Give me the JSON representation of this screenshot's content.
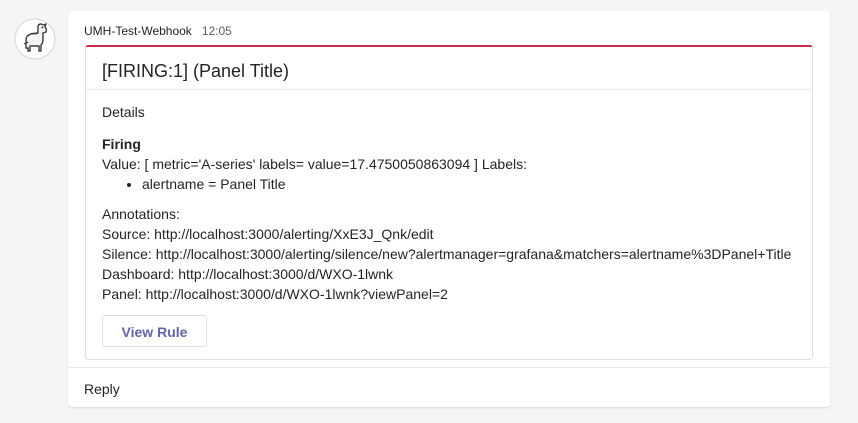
{
  "message": {
    "sender": "UMH-Test-Webhook",
    "time": "12:05",
    "avatar_icon": "llama-avatar-icon"
  },
  "card": {
    "accent_color": "#c4314b",
    "title": "[FIRING:1] (Panel Title)",
    "details_heading": "Details",
    "firing_heading": "Firing",
    "value_line": "Value: [ metric='A-series' labels= value=17.4750050863094 ] Labels:",
    "labels": [
      "alertname = Panel Title"
    ],
    "annotations": {
      "heading": "Annotations:",
      "source": "Source: http://localhost:3000/alerting/XxE3J_Qnk/edit",
      "silence": "Silence: http://localhost:3000/alerting/silence/new?alertmanager=grafana&matchers=alertname%3DPanel+Title",
      "dashboard": "Dashboard: http://localhost:3000/d/WXO-1lwnk",
      "panel": "Panel: http://localhost:3000/d/WXO-1lwnk?viewPanel=2"
    },
    "button_label": "View Rule",
    "button_color": "#6264a7"
  },
  "reply_label": "Reply"
}
